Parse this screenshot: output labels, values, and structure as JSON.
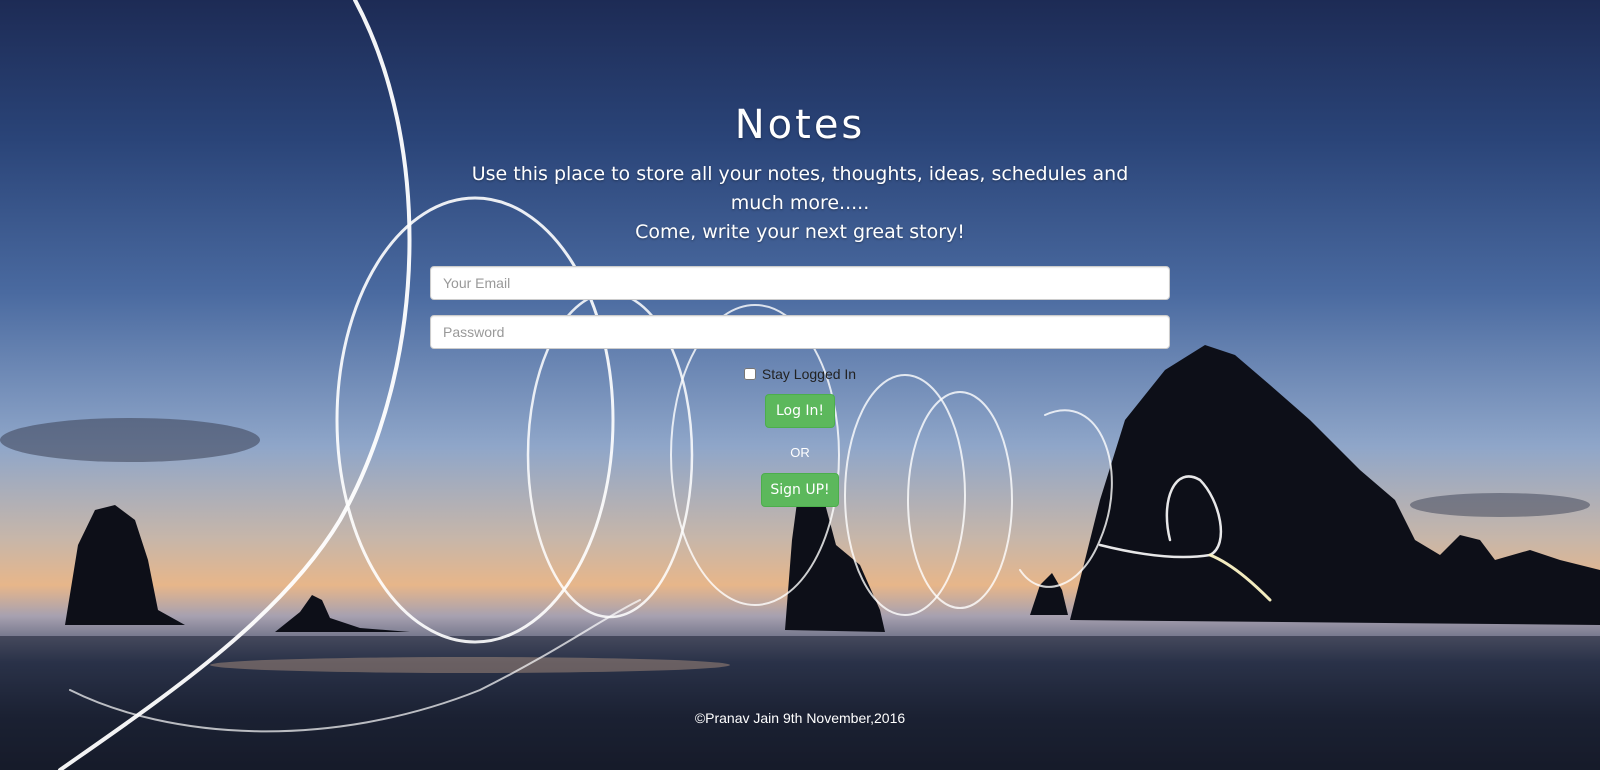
{
  "header": {
    "title": "Notes",
    "tagline_line1": "Use this place to store all your notes, thoughts, ideas, schedules and much more.....",
    "tagline_line2": "Come, write your next great story!"
  },
  "login_form": {
    "email_placeholder": "Your Email",
    "password_placeholder": "Password",
    "remember_label": "Stay Logged In",
    "remember_checked": false,
    "login_label": "Log In!",
    "or_label": "OR",
    "signup_label": "Sign UP!"
  },
  "footer": {
    "text": "©Pranav Jain 9th November,2016"
  },
  "colors": {
    "button_green": "#5cb85c",
    "button_border": "#4cae4c",
    "text_white": "#ffffff"
  }
}
